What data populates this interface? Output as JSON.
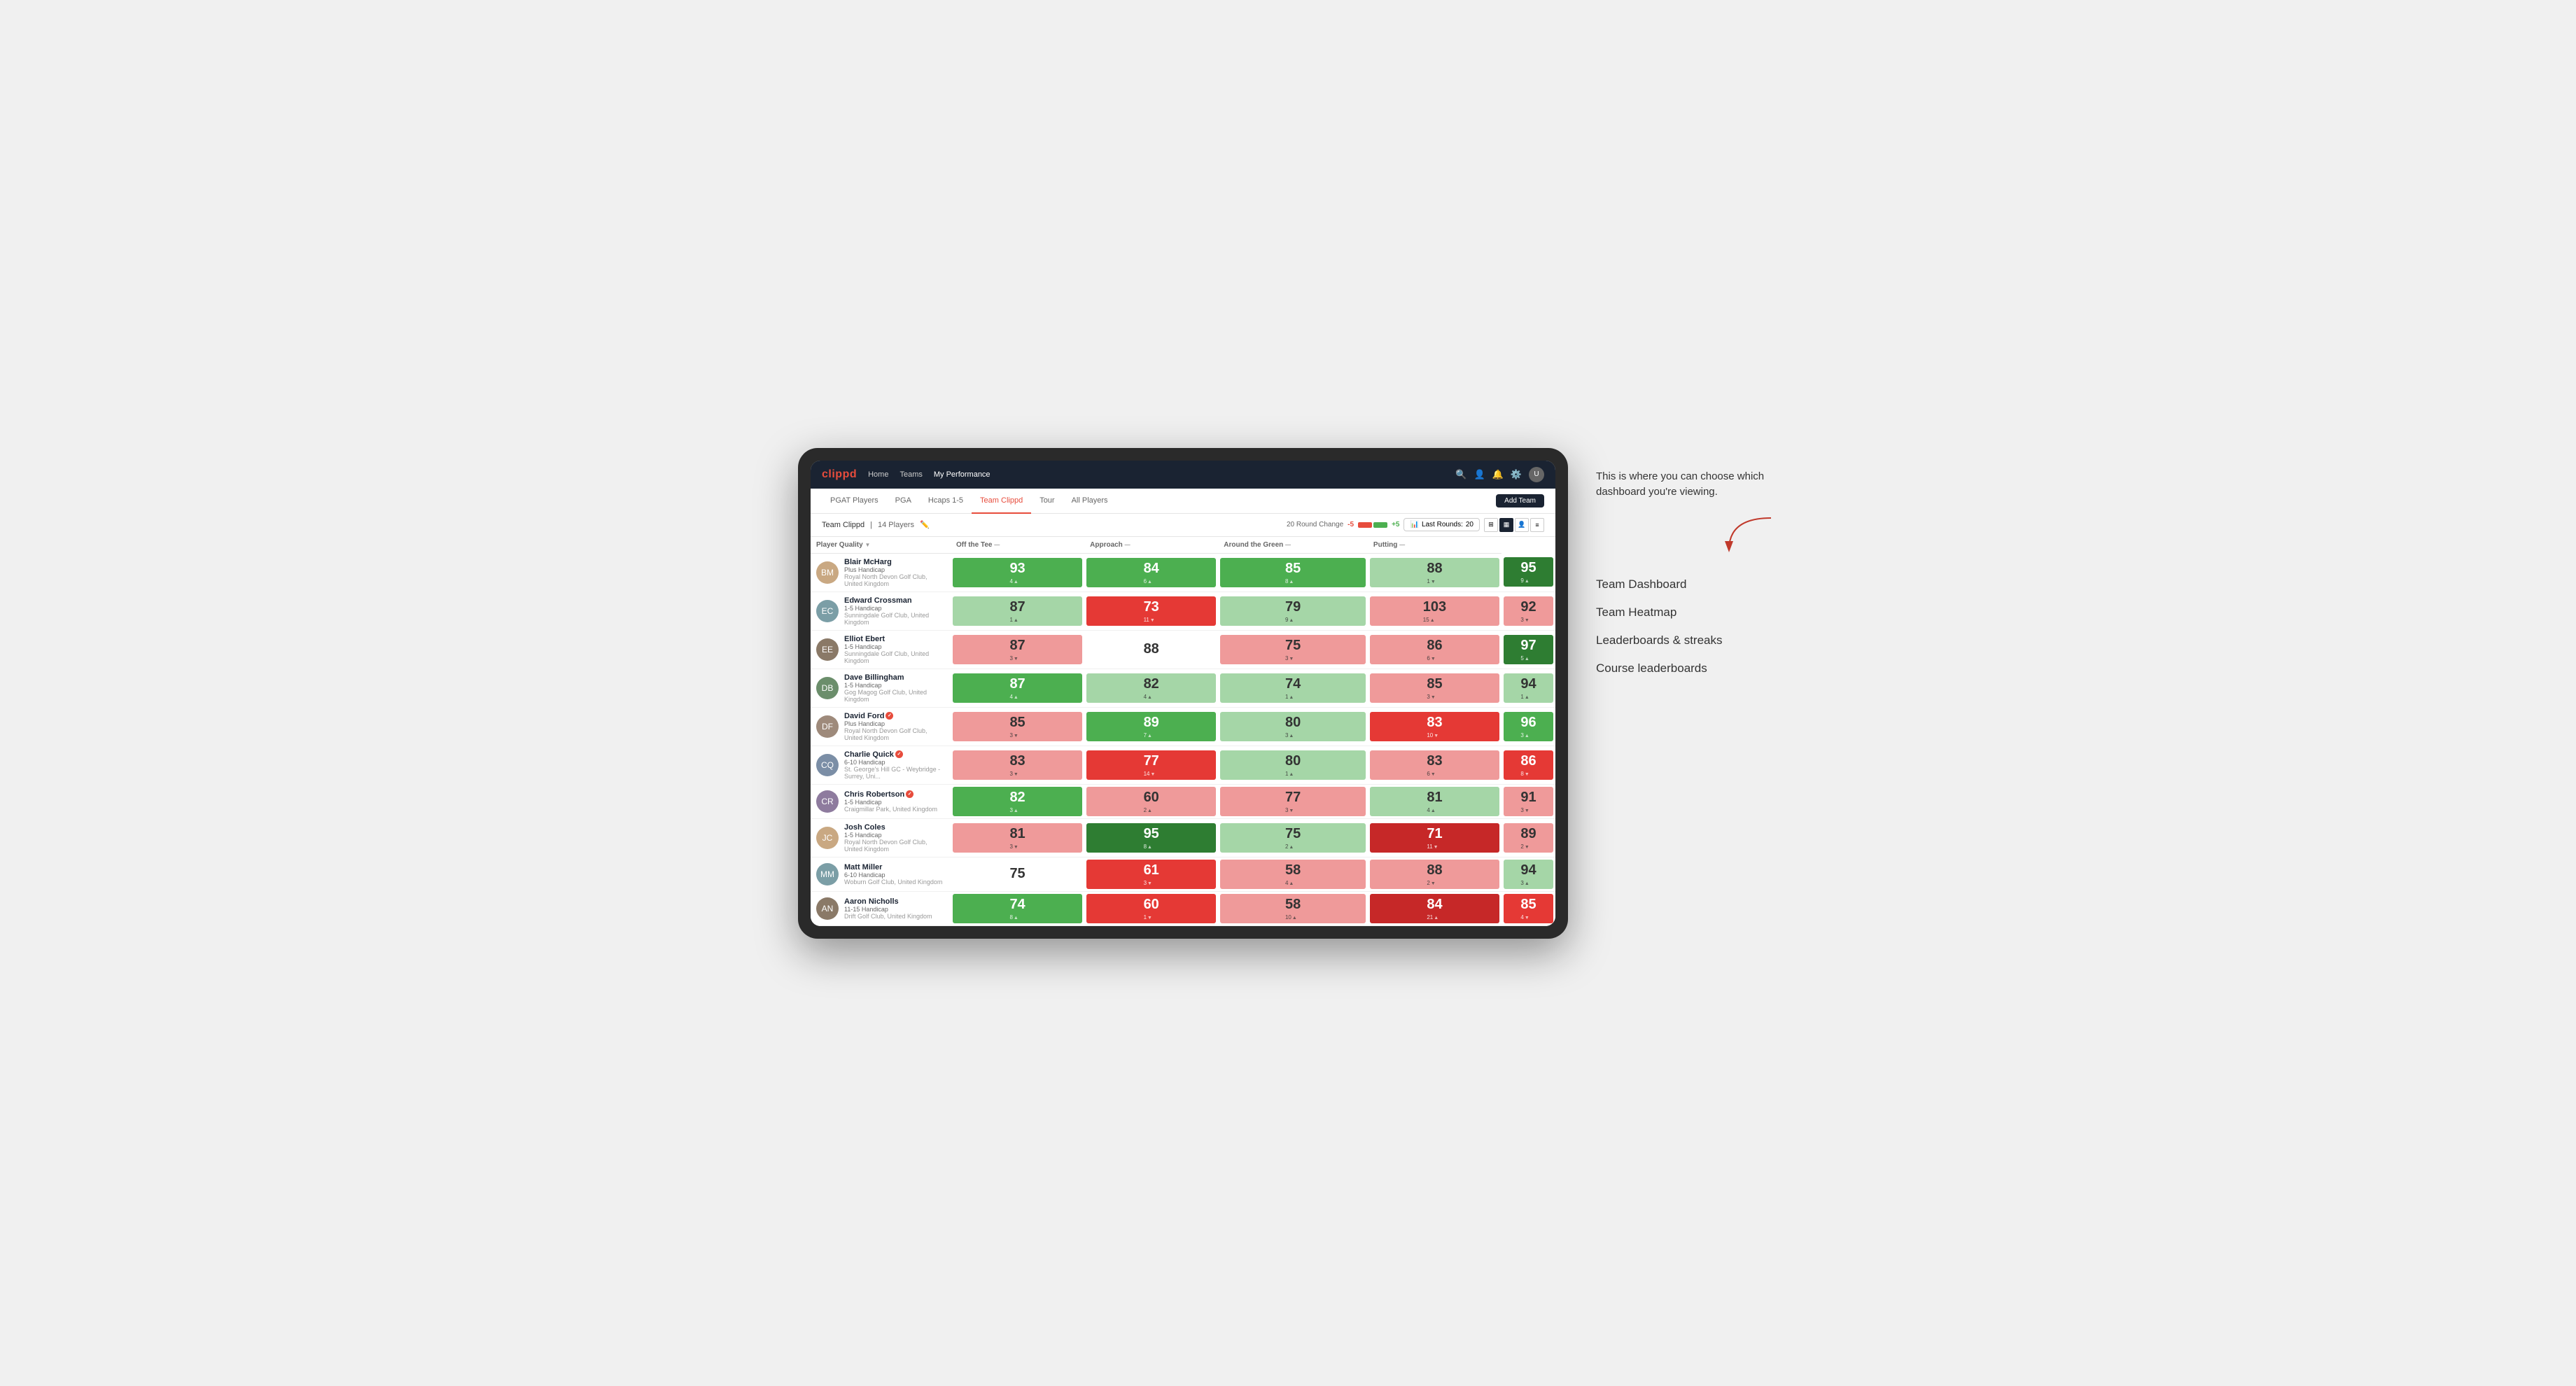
{
  "annotation": {
    "intro": "This is where you can choose which dashboard you're viewing.",
    "menu_items": [
      "Team Dashboard",
      "Team Heatmap",
      "Leaderboards & streaks",
      "Course leaderboards"
    ]
  },
  "navbar": {
    "logo": "clippd",
    "links": [
      "Home",
      "Teams",
      "My Performance"
    ],
    "active_link": "My Performance"
  },
  "sub_nav": {
    "tabs": [
      "PGAT Players",
      "PGA",
      "Hcaps 1-5",
      "Team Clippd",
      "Tour",
      "All Players"
    ],
    "active_tab": "Team Clippd",
    "add_team_label": "Add Team"
  },
  "team_header": {
    "name": "Team Clippd",
    "separator": "|",
    "count": "14 Players",
    "round_change_label": "20 Round Change",
    "change_negative": "-5",
    "change_positive": "+5",
    "last_rounds_label": "Last Rounds:",
    "last_rounds_value": "20"
  },
  "table": {
    "columns": [
      {
        "id": "player",
        "label": "Player Quality"
      },
      {
        "id": "off_tee",
        "label": "Off the Tee"
      },
      {
        "id": "approach",
        "label": "Approach"
      },
      {
        "id": "around_green",
        "label": "Around the Green"
      },
      {
        "id": "putting",
        "label": "Putting"
      }
    ],
    "players": [
      {
        "name": "Blair McHarg",
        "badge": false,
        "handicap": "Plus Handicap",
        "club": "Royal North Devon Golf Club, United Kingdom",
        "initials": "BM",
        "scores": {
          "player_quality": {
            "value": 93,
            "change": 4,
            "dir": "up",
            "color": "green-med"
          },
          "off_tee": {
            "value": 84,
            "change": 6,
            "dir": "up",
            "color": "green-med"
          },
          "approach": {
            "value": 85,
            "change": 8,
            "dir": "up",
            "color": "green-med"
          },
          "around_green": {
            "value": 88,
            "change": 1,
            "dir": "down",
            "color": "green-light"
          },
          "putting": {
            "value": 95,
            "change": 9,
            "dir": "up",
            "color": "green-dark"
          }
        }
      },
      {
        "name": "Edward Crossman",
        "badge": false,
        "handicap": "1-5 Handicap",
        "club": "Sunningdale Golf Club, United Kingdom",
        "initials": "EC",
        "scores": {
          "player_quality": {
            "value": 87,
            "change": 1,
            "dir": "up",
            "color": "green-light"
          },
          "off_tee": {
            "value": 73,
            "change": 11,
            "dir": "down",
            "color": "red-med"
          },
          "approach": {
            "value": 79,
            "change": 9,
            "dir": "up",
            "color": "green-light"
          },
          "around_green": {
            "value": 103,
            "change": 15,
            "dir": "up",
            "color": "red-light"
          },
          "putting": {
            "value": 92,
            "change": 3,
            "dir": "down",
            "color": "red-light"
          }
        }
      },
      {
        "name": "Elliot Ebert",
        "badge": false,
        "handicap": "1-5 Handicap",
        "club": "Sunningdale Golf Club, United Kingdom",
        "initials": "EE",
        "scores": {
          "player_quality": {
            "value": 87,
            "change": 3,
            "dir": "down",
            "color": "red-light"
          },
          "off_tee": {
            "value": 88,
            "change": null,
            "dir": null,
            "color": "white"
          },
          "approach": {
            "value": 75,
            "change": 3,
            "dir": "down",
            "color": "red-light"
          },
          "around_green": {
            "value": 86,
            "change": 6,
            "dir": "down",
            "color": "red-light"
          },
          "putting": {
            "value": 97,
            "change": 5,
            "dir": "up",
            "color": "green-dark"
          }
        }
      },
      {
        "name": "Dave Billingham",
        "badge": false,
        "handicap": "1-5 Handicap",
        "club": "Gog Magog Golf Club, United Kingdom",
        "initials": "DB",
        "scores": {
          "player_quality": {
            "value": 87,
            "change": 4,
            "dir": "up",
            "color": "green-med"
          },
          "off_tee": {
            "value": 82,
            "change": 4,
            "dir": "up",
            "color": "green-light"
          },
          "approach": {
            "value": 74,
            "change": 1,
            "dir": "up",
            "color": "green-light"
          },
          "around_green": {
            "value": 85,
            "change": 3,
            "dir": "down",
            "color": "red-light"
          },
          "putting": {
            "value": 94,
            "change": 1,
            "dir": "up",
            "color": "green-light"
          }
        }
      },
      {
        "name": "David Ford",
        "badge": true,
        "handicap": "Plus Handicap",
        "club": "Royal North Devon Golf Club, United Kingdom",
        "initials": "DF",
        "scores": {
          "player_quality": {
            "value": 85,
            "change": 3,
            "dir": "down",
            "color": "red-light"
          },
          "off_tee": {
            "value": 89,
            "change": 7,
            "dir": "up",
            "color": "green-med"
          },
          "approach": {
            "value": 80,
            "change": 3,
            "dir": "up",
            "color": "green-light"
          },
          "around_green": {
            "value": 83,
            "change": 10,
            "dir": "down",
            "color": "red-med"
          },
          "putting": {
            "value": 96,
            "change": 3,
            "dir": "up",
            "color": "green-med"
          }
        }
      },
      {
        "name": "Charlie Quick",
        "badge": true,
        "handicap": "6-10 Handicap",
        "club": "St. George's Hill GC - Weybridge - Surrey, Uni...",
        "initials": "CQ",
        "scores": {
          "player_quality": {
            "value": 83,
            "change": 3,
            "dir": "down",
            "color": "red-light"
          },
          "off_tee": {
            "value": 77,
            "change": 14,
            "dir": "down",
            "color": "red-med"
          },
          "approach": {
            "value": 80,
            "change": 1,
            "dir": "up",
            "color": "green-light"
          },
          "around_green": {
            "value": 83,
            "change": 6,
            "dir": "down",
            "color": "red-light"
          },
          "putting": {
            "value": 86,
            "change": 8,
            "dir": "down",
            "color": "red-med"
          }
        }
      },
      {
        "name": "Chris Robertson",
        "badge": true,
        "handicap": "1-5 Handicap",
        "club": "Craigmillar Park, United Kingdom",
        "initials": "CR",
        "scores": {
          "player_quality": {
            "value": 82,
            "change": 3,
            "dir": "up",
            "color": "green-med"
          },
          "off_tee": {
            "value": 60,
            "change": 2,
            "dir": "up",
            "color": "red-light"
          },
          "approach": {
            "value": 77,
            "change": 3,
            "dir": "down",
            "color": "red-light"
          },
          "around_green": {
            "value": 81,
            "change": 4,
            "dir": "up",
            "color": "green-light"
          },
          "putting": {
            "value": 91,
            "change": 3,
            "dir": "down",
            "color": "red-light"
          }
        }
      },
      {
        "name": "Josh Coles",
        "badge": false,
        "handicap": "1-5 Handicap",
        "club": "Royal North Devon Golf Club, United Kingdom",
        "initials": "JC",
        "scores": {
          "player_quality": {
            "value": 81,
            "change": 3,
            "dir": "down",
            "color": "red-light"
          },
          "off_tee": {
            "value": 95,
            "change": 8,
            "dir": "up",
            "color": "green-dark"
          },
          "approach": {
            "value": 75,
            "change": 2,
            "dir": "up",
            "color": "green-light"
          },
          "around_green": {
            "value": 71,
            "change": 11,
            "dir": "down",
            "color": "red-dark"
          },
          "putting": {
            "value": 89,
            "change": 2,
            "dir": "down",
            "color": "red-light"
          }
        }
      },
      {
        "name": "Matt Miller",
        "badge": false,
        "handicap": "6-10 Handicap",
        "club": "Woburn Golf Club, United Kingdom",
        "initials": "MM",
        "scores": {
          "player_quality": {
            "value": 75,
            "change": null,
            "dir": null,
            "color": "white"
          },
          "off_tee": {
            "value": 61,
            "change": 3,
            "dir": "down",
            "color": "red-med"
          },
          "approach": {
            "value": 58,
            "change": 4,
            "dir": "up",
            "color": "red-light"
          },
          "around_green": {
            "value": 88,
            "change": 2,
            "dir": "down",
            "color": "red-light"
          },
          "putting": {
            "value": 94,
            "change": 3,
            "dir": "up",
            "color": "green-light"
          }
        }
      },
      {
        "name": "Aaron Nicholls",
        "badge": false,
        "handicap": "11-15 Handicap",
        "club": "Drift Golf Club, United Kingdom",
        "initials": "AN",
        "scores": {
          "player_quality": {
            "value": 74,
            "change": 8,
            "dir": "up",
            "color": "green-med"
          },
          "off_tee": {
            "value": 60,
            "change": 1,
            "dir": "down",
            "color": "red-med"
          },
          "approach": {
            "value": 58,
            "change": 10,
            "dir": "up",
            "color": "red-light"
          },
          "around_green": {
            "value": 84,
            "change": 21,
            "dir": "up",
            "color": "red-dark"
          },
          "putting": {
            "value": 85,
            "change": 4,
            "dir": "down",
            "color": "red-med"
          }
        }
      }
    ]
  }
}
